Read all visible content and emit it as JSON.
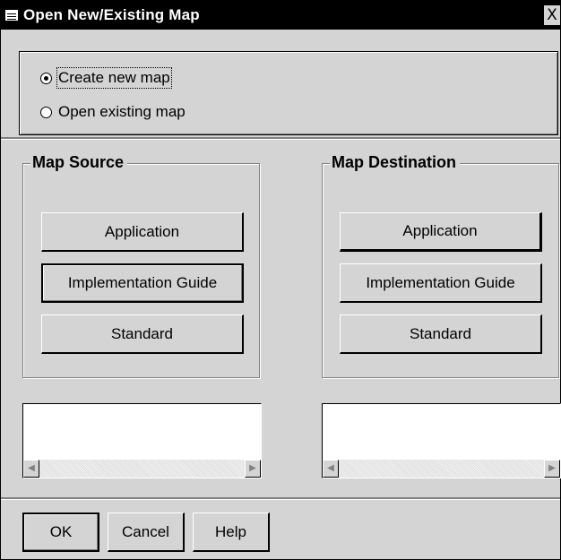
{
  "window": {
    "title": "Open New/Existing Map",
    "close_symbol": "X"
  },
  "mode": {
    "options": [
      {
        "label": "Create new map",
        "selected": true
      },
      {
        "label": "Open existing map",
        "selected": false
      }
    ]
  },
  "source": {
    "title": "Map Source",
    "buttons": [
      "Application",
      "Implementation Guide",
      "Standard"
    ]
  },
  "destination": {
    "title": "Map Destination",
    "buttons": [
      "Application",
      "Implementation Guide",
      "Standard"
    ]
  },
  "scroll": {
    "left_arrow": "◀",
    "right_arrow": "▶"
  },
  "footer": {
    "ok": "OK",
    "cancel": "Cancel",
    "help": "Help"
  }
}
